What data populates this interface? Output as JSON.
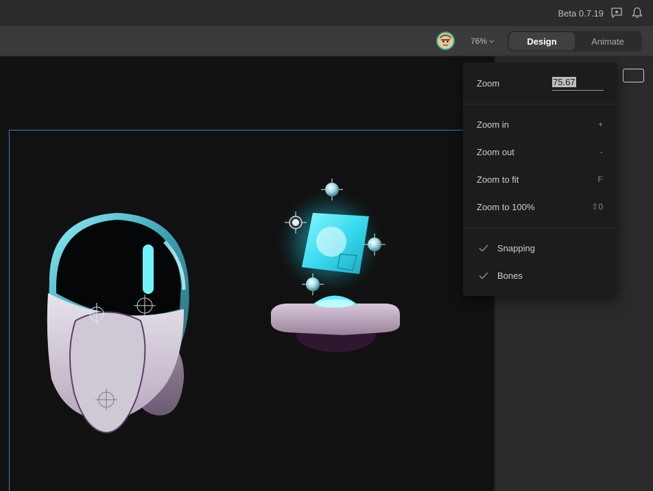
{
  "topbar": {
    "version": "Beta 0.7.19",
    "icons": [
      "feedback-icon",
      "bell-icon"
    ]
  },
  "toolbar": {
    "zoom_level": "76%",
    "modes": [
      {
        "label": "Design",
        "active": true
      },
      {
        "label": "Animate",
        "active": false
      }
    ]
  },
  "zoom_menu": {
    "zoom_label": "Zoom",
    "zoom_value": "75.67",
    "items": [
      {
        "label": "Zoom in",
        "shortcut": "+"
      },
      {
        "label": "Zoom out",
        "shortcut": "-"
      },
      {
        "label": "Zoom to fit",
        "shortcut": "F"
      },
      {
        "label": "Zoom to 100%",
        "shortcut": "⇧0"
      }
    ],
    "toggles": [
      {
        "label": "Snapping",
        "checked": true
      },
      {
        "label": "Bones",
        "checked": true
      }
    ]
  },
  "colors": {
    "accent_outline": "#3d7fc2",
    "avatar_ring": "#1fb38a",
    "glow_cyan": "#3ee6f2"
  }
}
